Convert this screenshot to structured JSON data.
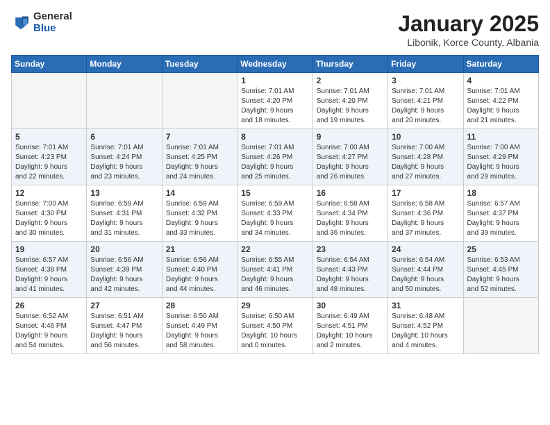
{
  "logo": {
    "general": "General",
    "blue": "Blue"
  },
  "header": {
    "title": "January 2025",
    "subtitle": "Libonik, Korce County, Albania"
  },
  "weekdays": [
    "Sunday",
    "Monday",
    "Tuesday",
    "Wednesday",
    "Thursday",
    "Friday",
    "Saturday"
  ],
  "weeks": [
    [
      {
        "day": "",
        "info": ""
      },
      {
        "day": "",
        "info": ""
      },
      {
        "day": "",
        "info": ""
      },
      {
        "day": "1",
        "info": "Sunrise: 7:01 AM\nSunset: 4:20 PM\nDaylight: 9 hours\nand 18 minutes."
      },
      {
        "day": "2",
        "info": "Sunrise: 7:01 AM\nSunset: 4:20 PM\nDaylight: 9 hours\nand 19 minutes."
      },
      {
        "day": "3",
        "info": "Sunrise: 7:01 AM\nSunset: 4:21 PM\nDaylight: 9 hours\nand 20 minutes."
      },
      {
        "day": "4",
        "info": "Sunrise: 7:01 AM\nSunset: 4:22 PM\nDaylight: 9 hours\nand 21 minutes."
      }
    ],
    [
      {
        "day": "5",
        "info": "Sunrise: 7:01 AM\nSunset: 4:23 PM\nDaylight: 9 hours\nand 22 minutes."
      },
      {
        "day": "6",
        "info": "Sunrise: 7:01 AM\nSunset: 4:24 PM\nDaylight: 9 hours\nand 23 minutes."
      },
      {
        "day": "7",
        "info": "Sunrise: 7:01 AM\nSunset: 4:25 PM\nDaylight: 9 hours\nand 24 minutes."
      },
      {
        "day": "8",
        "info": "Sunrise: 7:01 AM\nSunset: 4:26 PM\nDaylight: 9 hours\nand 25 minutes."
      },
      {
        "day": "9",
        "info": "Sunrise: 7:00 AM\nSunset: 4:27 PM\nDaylight: 9 hours\nand 26 minutes."
      },
      {
        "day": "10",
        "info": "Sunrise: 7:00 AM\nSunset: 4:28 PM\nDaylight: 9 hours\nand 27 minutes."
      },
      {
        "day": "11",
        "info": "Sunrise: 7:00 AM\nSunset: 4:29 PM\nDaylight: 9 hours\nand 29 minutes."
      }
    ],
    [
      {
        "day": "12",
        "info": "Sunrise: 7:00 AM\nSunset: 4:30 PM\nDaylight: 9 hours\nand 30 minutes."
      },
      {
        "day": "13",
        "info": "Sunrise: 6:59 AM\nSunset: 4:31 PM\nDaylight: 9 hours\nand 31 minutes."
      },
      {
        "day": "14",
        "info": "Sunrise: 6:59 AM\nSunset: 4:32 PM\nDaylight: 9 hours\nand 33 minutes."
      },
      {
        "day": "15",
        "info": "Sunrise: 6:59 AM\nSunset: 4:33 PM\nDaylight: 9 hours\nand 34 minutes."
      },
      {
        "day": "16",
        "info": "Sunrise: 6:58 AM\nSunset: 4:34 PM\nDaylight: 9 hours\nand 36 minutes."
      },
      {
        "day": "17",
        "info": "Sunrise: 6:58 AM\nSunset: 4:36 PM\nDaylight: 9 hours\nand 37 minutes."
      },
      {
        "day": "18",
        "info": "Sunrise: 6:57 AM\nSunset: 4:37 PM\nDaylight: 9 hours\nand 39 minutes."
      }
    ],
    [
      {
        "day": "19",
        "info": "Sunrise: 6:57 AM\nSunset: 4:38 PM\nDaylight: 9 hours\nand 41 minutes."
      },
      {
        "day": "20",
        "info": "Sunrise: 6:56 AM\nSunset: 4:39 PM\nDaylight: 9 hours\nand 42 minutes."
      },
      {
        "day": "21",
        "info": "Sunrise: 6:56 AM\nSunset: 4:40 PM\nDaylight: 9 hours\nand 44 minutes."
      },
      {
        "day": "22",
        "info": "Sunrise: 6:55 AM\nSunset: 4:41 PM\nDaylight: 9 hours\nand 46 minutes."
      },
      {
        "day": "23",
        "info": "Sunrise: 6:54 AM\nSunset: 4:43 PM\nDaylight: 9 hours\nand 48 minutes."
      },
      {
        "day": "24",
        "info": "Sunrise: 6:54 AM\nSunset: 4:44 PM\nDaylight: 9 hours\nand 50 minutes."
      },
      {
        "day": "25",
        "info": "Sunrise: 6:53 AM\nSunset: 4:45 PM\nDaylight: 9 hours\nand 52 minutes."
      }
    ],
    [
      {
        "day": "26",
        "info": "Sunrise: 6:52 AM\nSunset: 4:46 PM\nDaylight: 9 hours\nand 54 minutes."
      },
      {
        "day": "27",
        "info": "Sunrise: 6:51 AM\nSunset: 4:47 PM\nDaylight: 9 hours\nand 56 minutes."
      },
      {
        "day": "28",
        "info": "Sunrise: 6:50 AM\nSunset: 4:49 PM\nDaylight: 9 hours\nand 58 minutes."
      },
      {
        "day": "29",
        "info": "Sunrise: 6:50 AM\nSunset: 4:50 PM\nDaylight: 10 hours\nand 0 minutes."
      },
      {
        "day": "30",
        "info": "Sunrise: 6:49 AM\nSunset: 4:51 PM\nDaylight: 10 hours\nand 2 minutes."
      },
      {
        "day": "31",
        "info": "Sunrise: 6:48 AM\nSunset: 4:52 PM\nDaylight: 10 hours\nand 4 minutes."
      },
      {
        "day": "",
        "info": ""
      }
    ]
  ]
}
